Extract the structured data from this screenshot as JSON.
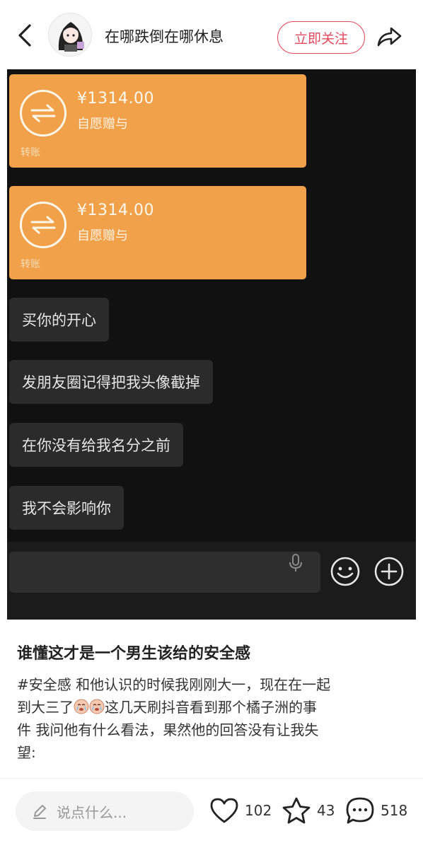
{
  "header": {
    "author_name": "在哪跌倒在哪休息",
    "follow_label": "立即关注"
  },
  "chat": {
    "transfers": [
      {
        "amount": "¥1314.00",
        "note": "自愿赠与",
        "tag": "转账"
      },
      {
        "amount": "¥1314.00",
        "note": "自愿赠与",
        "tag": "转账"
      }
    ],
    "messages": [
      "买你的开心",
      "发朋友圈记得把我头像截掉",
      "在你没有给我名分之前",
      "我不会影响你"
    ]
  },
  "post": {
    "title": "谁懂这才是一个男生该给的安全感",
    "hashtag": "#安全感",
    "line1": " 和他认识的时候我刚刚大一，现在在一起",
    "line2_a": "到大三了",
    "line2_b": "这几天刷抖音看到那个橘子洲的事",
    "line3": "件 我问他有什么看法，果然他的回答没有让我失",
    "line4": "望:"
  },
  "bottom": {
    "comment_placeholder": "说点什么...",
    "likes": "102",
    "stars": "43",
    "comments": "518"
  },
  "colors": {
    "accent": "#e6485b",
    "transfer_orange": "#f0a149",
    "chat_bg": "#111111"
  }
}
